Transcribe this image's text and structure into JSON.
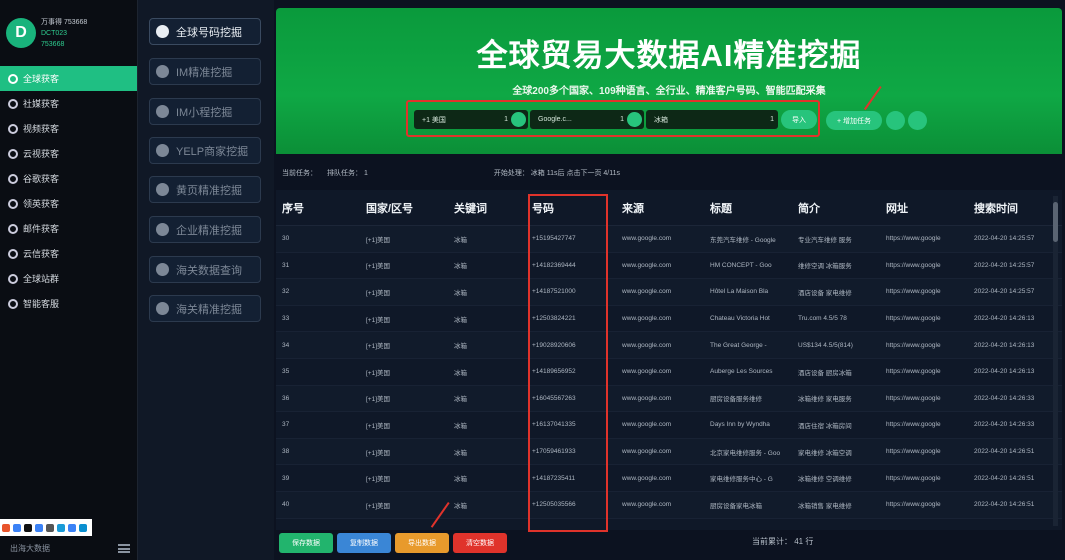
{
  "sidebar": {
    "profile": {
      "line1": "万事得 753668",
      "line2": "DCT023",
      "line3": "753668"
    },
    "items": [
      {
        "label": "全球获客",
        "active": true
      },
      {
        "label": "社媒获客",
        "active": false
      },
      {
        "label": "视频获客",
        "active": false
      },
      {
        "label": "云视获客",
        "active": false
      },
      {
        "label": "谷歌获客",
        "active": false
      },
      {
        "label": "领英获客",
        "active": false
      },
      {
        "label": "邮件获客",
        "active": false
      },
      {
        "label": "云信获客",
        "active": false
      },
      {
        "label": "全球站群",
        "active": false
      },
      {
        "label": "智能客服",
        "active": false
      }
    ],
    "bottom_label": "出海大数据"
  },
  "col2": {
    "items": [
      {
        "label": "全球号码挖掘",
        "icon": "globe-icon",
        "active": true
      },
      {
        "label": "IM精准挖掘",
        "icon": "im-icon",
        "active": false
      },
      {
        "label": "IM小程挖掘",
        "icon": "im-mini-icon",
        "active": false
      },
      {
        "label": "YELP商家挖掘",
        "icon": "yelp-icon",
        "active": false
      },
      {
        "label": "黄页精准挖掘",
        "icon": "yellowpage-icon",
        "active": false
      },
      {
        "label": "企业精准挖掘",
        "icon": "enterprise-icon",
        "active": false
      },
      {
        "label": "海关数据查询",
        "icon": "customs-icon",
        "active": false
      },
      {
        "label": "海关精准挖掘",
        "icon": "facebook-icon",
        "active": false
      }
    ]
  },
  "banner": {
    "title": "全球贸易大数据AI精准挖掘",
    "subtitle": "全球200多个国家、109种语言、全行业、精准客户号码、智能匹配采集",
    "fields": [
      {
        "value": "+1 美国",
        "count": "1"
      },
      {
        "value": "Google.c...",
        "count": "1"
      },
      {
        "value": "冰箱",
        "count": "1"
      }
    ],
    "import_label": "导入",
    "add_label": "+ 增加任务"
  },
  "status": {
    "current_task": "当前任务：",
    "queue": "排队任务： 1",
    "progress": "开始处理： 冰箱  11s后  点击下一页  4/11s"
  },
  "table": {
    "headers": [
      "序号",
      "国家/区号",
      "关键词",
      "号码",
      "来源",
      "标题",
      "简介",
      "网址",
      "搜索时间"
    ],
    "rows": [
      [
        "30",
        "[+1]美国",
        "冰箱",
        "+15195427747",
        "www.google.com",
        "东莞汽车维修 - Google",
        "专业汽车维修   服务",
        "https://www.google",
        "2022-04-20 14:25:57"
      ],
      [
        "31",
        "[+1]美国",
        "冰箱",
        "+14182369444",
        "www.google.com",
        "HM CONCEPT - Goo",
        "维修空调   冰箱服务",
        "https://www.google",
        "2022-04-20 14:25:57"
      ],
      [
        "32",
        "[+1]美国",
        "冰箱",
        "+14187521000",
        "www.google.com",
        "Hôtel La Maison Bla",
        "酒店设备   家电维修",
        "https://www.google",
        "2022-04-20 14:25:57"
      ],
      [
        "33",
        "[+1]美国",
        "冰箱",
        "+12503824221",
        "www.google.com",
        "Chateau Victoria Hot",
        "Tru.com  4.5/5  78",
        "https://www.google",
        "2022-04-20 14:26:13"
      ],
      [
        "34",
        "[+1]美国",
        "冰箱",
        "+19028920606",
        "www.google.com",
        "The Great George -",
        "US$134   4.5/5(814)",
        "https://www.google",
        "2022-04-20 14:26:13"
      ],
      [
        "35",
        "[+1]美国",
        "冰箱",
        "+14189656952",
        "www.google.com",
        "Auberge Les Sources",
        "酒店设备   厨房冰箱",
        "https://www.google",
        "2022-04-20 14:26:13"
      ],
      [
        "36",
        "[+1]美国",
        "冰箱",
        "+16045567263",
        "www.google.com",
        "厨房设备服务维修",
        "冰箱维修   家电服务",
        "https://www.google",
        "2022-04-20 14:26:33"
      ],
      [
        "37",
        "[+1]美国",
        "冰箱",
        "+16137041335",
        "www.google.com",
        "Days Inn by Wyndha",
        "酒店住宿   冰箱房间",
        "https://www.google",
        "2022-04-20 14:26:33"
      ],
      [
        "38",
        "[+1]美国",
        "冰箱",
        "+17059461933",
        "www.google.com",
        "北京家电维修服务 - Goo",
        "家电维修   冰箱空调",
        "https://www.google",
        "2022-04-20 14:26:51"
      ],
      [
        "39",
        "[+1]美国",
        "冰箱",
        "+14187235411",
        "www.google.com",
        "家电维修服务中心 - G",
        "冰箱维修   空调维修",
        "https://www.google",
        "2022-04-20 14:26:51"
      ],
      [
        "40",
        "[+1]美国",
        "冰箱",
        "+12505035566",
        "www.google.com",
        "厨房设备家电冰箱",
        "冰箱销售   家电维修",
        "https://www.google",
        "2022-04-20 14:26:51"
      ]
    ]
  },
  "buttons": {
    "b1": "保存数据",
    "b2": "复制数据",
    "b3": "导出数据",
    "b4": "清空数据"
  },
  "total_label": "当前累计：  41  行",
  "colors": {
    "accent": "#1fbf83",
    "banner": "#0fa845",
    "highlight": "#e0332b"
  }
}
